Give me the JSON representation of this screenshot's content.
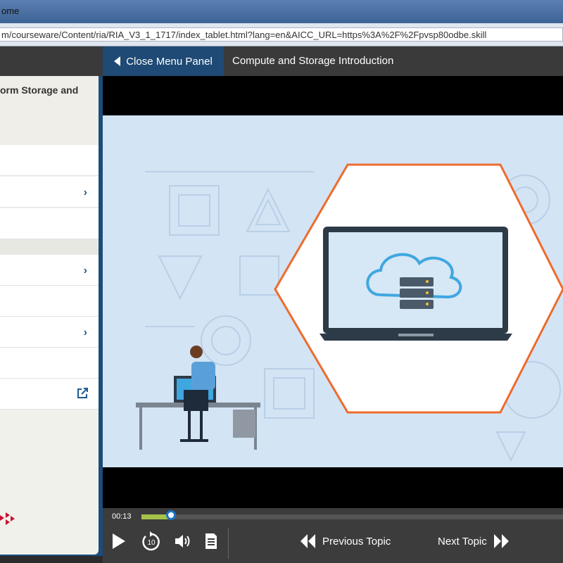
{
  "browser": {
    "title_fragment": "ome",
    "url": "m/courseware/Content/ria/RIA_V3_1_1717/index_tablet.html?lang=en&AICC_URL=https%3A%2F%2Fpvsp80odbe.skill"
  },
  "header": {
    "close_menu_label": "Close Menu Panel",
    "course_title": "Compute and Storage Introduction"
  },
  "menu": {
    "title": "orm Storage and",
    "items": [
      {
        "label": "",
        "has_chevron": false
      },
      {
        "label": "",
        "has_chevron": true
      },
      {
        "label": "",
        "has_chevron": false
      },
      {
        "label": "",
        "has_chevron": true
      },
      {
        "label": "",
        "has_chevron": false
      },
      {
        "label": "",
        "has_chevron": true
      },
      {
        "label": "",
        "has_chevron": false
      },
      {
        "label": "",
        "has_external_link": true
      }
    ]
  },
  "player": {
    "time": "00:13",
    "progress_fraction": 0.07,
    "replay_seconds": "10",
    "previous_label": "Previous Topic",
    "next_label": "Next Topic"
  },
  "colors": {
    "accent_blue": "#1e4a75",
    "hexagon_orange": "#ee6b2b",
    "progress_green": "#a7c44a",
    "knob_blue": "#1a74c9",
    "scene_bg": "#d3e4f5"
  }
}
